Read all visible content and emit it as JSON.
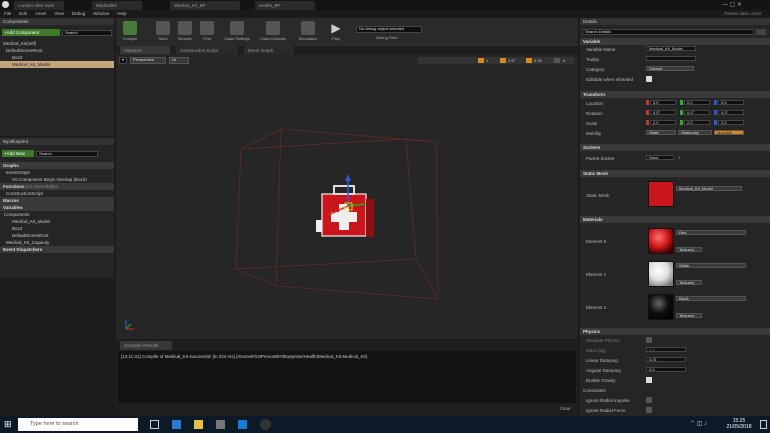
{
  "window": {
    "tabs": [
      "London After Dark",
      "MedicalKit",
      "Medical_Kit_BP",
      "Health_BP"
    ],
    "right_label": "Parent class: Actor"
  },
  "menu": [
    "File",
    "Edit",
    "Asset",
    "View",
    "Debug",
    "Window",
    "Help"
  ],
  "toolbar": {
    "buttons": [
      "Compile",
      "Save",
      "Browse",
      "Find",
      "Class Settings",
      "Class Defaults",
      "Simulation",
      "Play"
    ],
    "debug_select": "No debug object selected",
    "debug_filter": "Debug Filter"
  },
  "components": {
    "title": "Components",
    "add_label": "+Add Component",
    "search_placeholder": "Search",
    "items": [
      "Medical_Kit(self)",
      "DefaultSceneRoot",
      "Box3",
      "Medical_Kit_Model"
    ]
  },
  "mybp": {
    "title": "My Blueprint",
    "add_label": "+Add New",
    "search_placeholder": "Search",
    "graphs": "Graphs",
    "eventgraph": "EventGraph",
    "event_item": "On Component Begin Overlap (Box3)",
    "functions": "Functions",
    "functions_note": "(21 Overridable)",
    "construction": "ConstructionScript",
    "macros": "Macros",
    "variables": "Variables",
    "components_cat": "Components",
    "var_items": [
      "Medical_Kit_Model",
      "Box3",
      "DefaultSceneRoot",
      "Medical_Kit_Capacity"
    ],
    "dispatchers": "Event Dispatchers"
  },
  "center": {
    "tabs": [
      "Viewport",
      "Construction Script",
      "Event Graph"
    ],
    "perspective": "Perspective",
    "lit": "Lit",
    "snap_values": [
      "1",
      "2.5°",
      "0.25",
      "4"
    ]
  },
  "compiler": {
    "title": "Compiler Results",
    "message": "[13:11:31] Compile of Medical_Kit successful! [in 224 ms] (/Game/FirstPersonBP/Blueprints/Health/Medical_Kit.Medical_Kit)",
    "clear": "Clear"
  },
  "details": {
    "title": "Details",
    "search_placeholder": "Search Details",
    "variable": {
      "title": "Variable",
      "name_label": "Variable Name",
      "name_value": "Medical_Kit_Model",
      "tooltip_label": "Tooltip",
      "category_label": "Category",
      "category_value": "Default",
      "editable_label": "Editable when Inherited"
    },
    "transform": {
      "title": "Transform",
      "location": "Location",
      "rotation": "Rotation",
      "scale": "Scale",
      "mobility": "Mobility",
      "loc": [
        "0.0",
        "0.0",
        "0.0"
      ],
      "rot": [
        "0.0°",
        "0.0°",
        "0.0°"
      ],
      "scl": [
        "2.0",
        "2.0",
        "2.0"
      ],
      "mob": [
        "Static",
        "Stationary",
        "Movable"
      ]
    },
    "sockets": {
      "title": "Sockets",
      "parent_label": "Parent Socket",
      "parent_value": "None"
    },
    "static_mesh": {
      "title": "Static Mesh",
      "label": "Static Mesh",
      "value": "Medical_Kit_Model"
    },
    "materials": {
      "title": "Materials",
      "elements": [
        {
          "label": "Element 0",
          "value": "Red",
          "color": "#d01a1a"
        },
        {
          "label": "Element 1",
          "value": "White",
          "color": "#e8e8e8"
        },
        {
          "label": "Element 2",
          "value": "Black",
          "color": "#111111"
        }
      ],
      "textures": "Textures"
    },
    "physics": {
      "title": "Physics",
      "items": [
        "Simulate Physics",
        "Mass (kg)",
        "Linear Damping",
        "Angular Damping",
        "Enable Gravity",
        "Constraints",
        "Ignore Radial Impulse",
        "Ignore Radial Force"
      ],
      "mass_value": "0.0",
      "linear": "0.01",
      "angular": "0.0"
    }
  },
  "taskbar": {
    "search": "Type here to search",
    "time": "15:25",
    "date": "21/05/2018"
  }
}
